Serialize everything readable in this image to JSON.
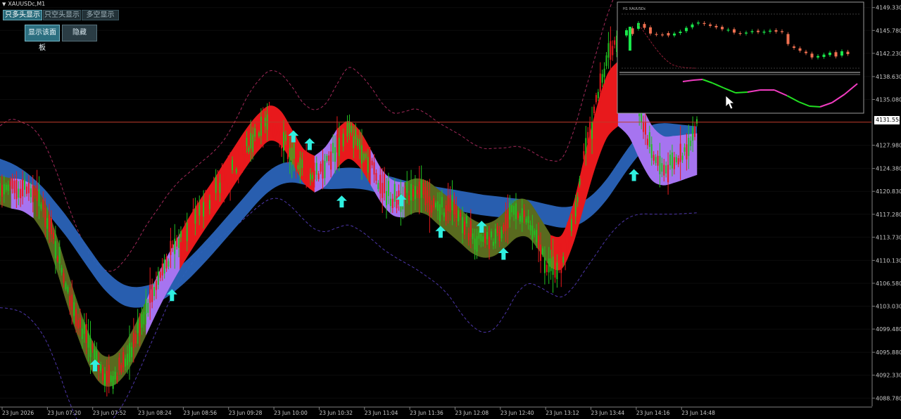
{
  "window": {
    "title": "XAUUSDc,M1"
  },
  "toolbar": {
    "buttons": [
      {
        "label": "只多头显示",
        "active": true
      },
      {
        "label": "只空头显示",
        "active": false
      },
      {
        "label": "多空显示",
        "active": false
      }
    ],
    "panel_buttons": [
      {
        "label": "显示该面板"
      },
      {
        "label": "隐藏"
      }
    ]
  },
  "current_price": "4131.558",
  "inset": {
    "title": "H1 XAUUSDc"
  },
  "colors": {
    "background": "#000000",
    "bull_band": "#e8191c",
    "bear_band": "#596a1f",
    "neutral_band": "#a674f0",
    "slow_band": "#2a63b8",
    "arrow": "#2ff0e0",
    "candle_up": "#22c022",
    "candle_down": "#e8191c",
    "envelope_upper": "#c0306a",
    "envelope_lower": "#5a40c8",
    "price_line": "#c03a2a",
    "inset_candle_up": "#19e64a",
    "inset_candle_down": "#f07050",
    "inset_line_up": "#22e022",
    "inset_line_down": "#f03cc0"
  },
  "chart_data": {
    "type": "line",
    "symbol": "XAUUSDc",
    "timeframe": "M1",
    "x_ticks": [
      "23 Jun 2026",
      "23 Jun 07:20",
      "23 Jun 07:52",
      "23 Jun 08:24",
      "23 Jun 08:56",
      "23 Jun 09:28",
      "23 Jun 10:00",
      "23 Jun 10:32",
      "23 Jun 11:04",
      "23 Jun 11:36",
      "23 Jun 12:08",
      "23 Jun 12:40",
      "23 Jun 13:12",
      "23 Jun 13:44",
      "23 Jun 14:16",
      "23 Jun 14:48"
    ],
    "y_ticks": [
      "4149.330",
      "4145.780",
      "4142.230",
      "4138.630",
      "4135.080",
      "4131.558",
      "4127.980",
      "4124.380",
      "4120.830",
      "4117.280",
      "4113.730",
      "4110.130",
      "4106.580",
      "4103.030",
      "4099.480",
      "4095.880",
      "4092.330",
      "4088.780"
    ],
    "ylim": [
      4087.5,
      4150.5
    ],
    "current_price": 4131.558,
    "series": [
      {
        "name": "",
        "role": "price",
        "values": [
          4122,
          4121,
          4121.5,
          4120.5,
          4118,
          4112,
          4106,
          4101,
          4096.5,
          4093,
          4092,
          4094,
          4098,
          4103,
          4107,
          4110.5,
          4113.5,
          4116.5,
          4118.5,
          4120.5,
          4122.5,
          4125,
          4127.8,
          4130,
          4131.5,
          4129.5,
          4126.5,
          4124.5,
          4123.5,
          4125,
          4128,
          4130.3,
          4128.2,
          4125,
          4121.5,
          4119.5,
          4120.2,
          4121.5,
          4119.5,
          4118,
          4118.5,
          4117,
          4114,
          4112.8,
          4113.5,
          4116,
          4118,
          4116,
          4112,
          4108.5,
          4110,
          4117,
          4126,
          4134,
          4142,
          4145,
          4141,
          4133,
          4127,
          4124,
          4125,
          4127.5,
          4131
        ]
      },
      {
        "name": "",
        "role": "fast band center",
        "values": [
          4121,
          4120.5,
          4120.2,
          4119.2,
          4116.5,
          4111.5,
          4105.8,
          4100.5,
          4096,
          4093.3,
          4093,
          4094.6,
          4097.5,
          4101.2,
          4105,
          4108.4,
          4111.5,
          4114.5,
          4117.2,
          4119.8,
          4122.5,
          4125.2,
          4127.8,
          4130,
          4131.4,
          4130.6,
          4127.8,
          4124.8,
          4123.5,
          4124.8,
          4127.5,
          4128.8,
          4127.4,
          4124.5,
          4121.5,
          4119.8,
          4119.5,
          4120.2,
          4119.8,
          4118.4,
          4117,
          4115.4,
          4113.9,
          4113.2,
          4113.6,
          4115,
          4116.6,
          4116.5,
          4114.2,
          4111.5,
          4111.5,
          4115.8,
          4122.5,
          4129,
          4134,
          4136,
          4134,
          4130,
          4126.8,
          4125.6,
          4125.8,
          4126.2,
          4126.6
        ]
      },
      {
        "name": "",
        "role": "fast band half-width",
        "values": [
          2.2,
          2.3,
          2.4,
          2.5,
          2.6,
          2.6,
          2.6,
          2.5,
          2.4,
          2.3,
          2.3,
          2.4,
          2.5,
          2.6,
          2.7,
          2.7,
          2.7,
          2.8,
          2.8,
          2.8,
          2.9,
          2.9,
          2.9,
          2.8,
          2.7,
          2.6,
          2.5,
          2.6,
          2.8,
          3,
          3,
          2.9,
          2.8,
          2.7,
          2.6,
          2.7,
          2.7,
          2.6,
          2.6,
          2.7,
          2.7,
          2.6,
          2.6,
          2.6,
          2.7,
          2.8,
          2.9,
          2.8,
          2.6,
          2.5,
          2.6,
          3,
          3.6,
          4.2,
          4.8,
          5,
          4.8,
          4.5,
          4.2,
          3.8,
          3.6,
          3.4,
          3.2
        ]
      },
      {
        "name": "",
        "role": "slow band center",
        "values": [
          4124.3,
          4123.6,
          4122.6,
          4121.2,
          4119.5,
          4117.4,
          4115.2,
          4112.7,
          4110.2,
          4107.8,
          4106,
          4104.8,
          4104.4,
          4104.6,
          4105.2,
          4106.2,
          4107.6,
          4109.2,
          4111,
          4112.9,
          4114.9,
          4116.9,
          4118.9,
          4120.9,
          4122.5,
          4123.5,
          4123.8,
          4123.5,
          4123,
          4122.8,
          4122.8,
          4122.9,
          4122.8,
          4122.5,
          4121.9,
          4121.4,
          4120.9,
          4120.5,
          4120.2,
          4119.9,
          4119.6,
          4119.3,
          4119,
          4118.7,
          4118.5,
          4118.3,
          4118.1,
          4117.9,
          4117.5,
          4117.1,
          4116.8,
          4117,
          4117.8,
          4119.2,
          4121.2,
          4123.7,
          4126.2,
          4128.3,
          4129.5,
          4129.8,
          4129.7,
          4129.5,
          4129.3
        ]
      },
      {
        "name": "",
        "role": "slow band half-width",
        "values": [
          1.6,
          1.6,
          1.6,
          1.6,
          1.6,
          1.6,
          1.6,
          1.6,
          1.6,
          1.6,
          1.6,
          1.6,
          1.6,
          1.6,
          1.6,
          1.6,
          1.6,
          1.6,
          1.6,
          1.6,
          1.6,
          1.6,
          1.6,
          1.6,
          1.6,
          1.6,
          1.6,
          1.6,
          1.6,
          1.6,
          1.6,
          1.6,
          1.6,
          1.6,
          1.6,
          1.6,
          1.6,
          1.6,
          1.6,
          1.6,
          1.6,
          1.6,
          1.6,
          1.6,
          1.6,
          1.6,
          1.6,
          1.6,
          1.6,
          1.6,
          1.6,
          1.6,
          1.6,
          1.6,
          1.6,
          1.6,
          1.6,
          1.6,
          1.6,
          1.6,
          1.6,
          1.6,
          1.6
        ]
      },
      {
        "name": "",
        "role": "upper envelope",
        "values": [
          4131,
          4132,
          4131.5,
          4130.5,
          4128,
          4124,
          4119,
          4114.5,
          4111,
          4109,
          4108.5,
          4110,
          4112.5,
          4115.5,
          4118,
          4120.5,
          4122.5,
          4124,
          4125.5,
          4127,
          4129,
          4132,
          4135.5,
          4138,
          4139.5,
          4139,
          4137,
          4134.5,
          4133.5,
          4134.5,
          4137.5,
          4140,
          4139,
          4137,
          4134.5,
          4133,
          4133.2,
          4133.6,
          4132.8,
          4131.5,
          4130.5,
          4129.5,
          4128.3,
          4127.5,
          4127.5,
          4127.6,
          4127.8,
          4127.3,
          4126.3,
          4125.6,
          4126,
          4130,
          4136,
          4142,
          4148,
          4152,
          4152,
          4152,
          4152,
          4152,
          4152,
          4152,
          4152
        ]
      },
      {
        "name": "",
        "role": "lower envelope",
        "values": [
          4102.8,
          4102.6,
          4102,
          4100.5,
          4098,
          4094,
          4089,
          4085,
          4083.5,
          4084,
          4085.5,
          4088,
          4091.5,
          4095.5,
          4099.5,
          4103.5,
          4106.8,
          4109.5,
          4111.5,
          4113,
          4114.2,
          4115.5,
          4117,
          4118.5,
          4119.6,
          4119.6,
          4118.3,
          4116.5,
          4115,
          4114.6,
          4115.2,
          4115.6,
          4114.8,
          4113.5,
          4112,
          4110.8,
          4109.8,
          4108.8,
          4107.6,
          4106.3,
          4104.5,
          4102,
          4100,
          4099,
          4099.6,
          4102,
          4105,
          4106.5,
          4106,
          4105,
          4104.5,
          4106,
          4108.5,
          4111,
          4113.5,
          4115.5,
          4116.8,
          4117.3,
          4117.3,
          4117.3,
          4117.3,
          4117.4,
          4117.5
        ]
      }
    ],
    "arrows": [
      {
        "x_index": 8.45,
        "y": 4093.8
      },
      {
        "x_index": 15.3,
        "y": 4104.7
      },
      {
        "x_index": 26.1,
        "y": 4129.3
      },
      {
        "x_index": 27.55,
        "y": 4128.1
      },
      {
        "x_index": 30.4,
        "y": 4119.2
      },
      {
        "x_index": 35.7,
        "y": 4119.4
      },
      {
        "x_index": 39.2,
        "y": 4114.5
      },
      {
        "x_index": 42.85,
        "y": 4115.3
      },
      {
        "x_index": 44.8,
        "y": 4111.1
      },
      {
        "x_index": 56.4,
        "y": 4123.3
      }
    ],
    "segments": [
      {
        "from": 0,
        "to": 1,
        "state": "bear"
      },
      {
        "from": 1,
        "to": 3,
        "state": "neutral"
      },
      {
        "from": 3,
        "to": 13,
        "state": "bear"
      },
      {
        "from": 13,
        "to": 16,
        "state": "neutral"
      },
      {
        "from": 16,
        "to": 28,
        "state": "bull"
      },
      {
        "from": 28,
        "to": 30,
        "state": "neutral"
      },
      {
        "from": 30,
        "to": 33,
        "state": "bull"
      },
      {
        "from": 33,
        "to": 36,
        "state": "neutral"
      },
      {
        "from": 36,
        "to": 49,
        "state": "bear"
      },
      {
        "from": 49,
        "to": 55,
        "state": "bull"
      },
      {
        "from": 55,
        "to": 62,
        "state": "neutral"
      }
    ]
  }
}
